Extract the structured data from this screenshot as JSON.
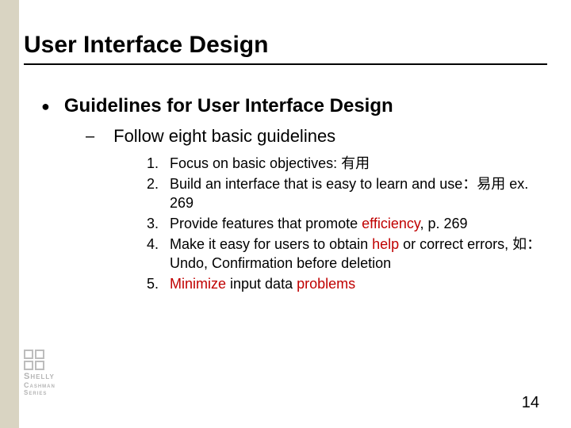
{
  "title": "User Interface Design",
  "bullet1": "Guidelines for User Interface Design",
  "bullet2": "Follow eight basic guidelines",
  "items": [
    {
      "n": "1.",
      "pre": "Focus on basic objectives: 有用",
      "em": "",
      "post": ""
    },
    {
      "n": "2.",
      "pre": "Build an interface that is easy to learn and use：易用 ex. 269",
      "em": "",
      "post": ""
    },
    {
      "n": "3.",
      "pre": "Provide features that promote ",
      "em": "efficiency",
      "post": ", p. 269"
    },
    {
      "n": "4.",
      "pre": "Make it easy for users to obtain ",
      "em": "help",
      "post": " or correct errors, 如：Undo, Confirmation before deletion"
    },
    {
      "n": "5.",
      "pre": "",
      "em": "Minimize",
      "post": " input data ",
      "em2": "problems"
    }
  ],
  "pageNumber": "14",
  "logo": {
    "l1": "Shelly",
    "l2": "Cashman",
    "l3": "Series"
  }
}
